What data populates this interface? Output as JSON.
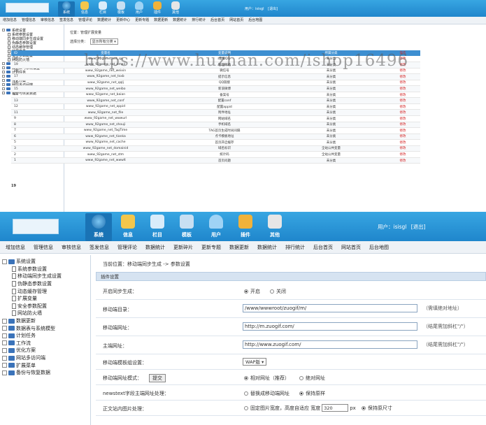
{
  "colors": {
    "header_blue": "#2a96da",
    "menu_bg": "#eef2f6",
    "table_head": "#3d8fd1",
    "op_red": "#d42020"
  },
  "shot1": {
    "nav_icons": [
      {
        "label": "系统",
        "icon": "globe-icon",
        "active": true
      },
      {
        "label": "信息",
        "icon": "pencil-icon"
      },
      {
        "label": "栏目",
        "icon": "folder-icon"
      },
      {
        "label": "模板",
        "icon": "template-icon"
      },
      {
        "label": "用户",
        "icon": "user-icon"
      },
      {
        "label": "插件",
        "icon": "tools-icon"
      },
      {
        "label": "其他",
        "icon": "gear-icon"
      }
    ],
    "user": {
      "label": "用户：isisgl",
      "logout": "[退出]"
    },
    "menu": [
      "增加信息",
      "管理信息",
      "审核信息",
      "签发信息",
      "管理评论",
      "数据统计",
      "更新中心",
      "更新专题",
      "数据更新",
      "数据统计",
      "排行统计",
      "后台首页",
      "网站首页",
      "后台地图"
    ],
    "tree": [
      {
        "label": "系统设置",
        "level": 0,
        "type": "folder"
      },
      {
        "label": "系统参数设置",
        "level": 1,
        "type": "doc"
      },
      {
        "label": "移动端同步生成设置",
        "level": 1,
        "type": "doc"
      },
      {
        "label": "伪静态参数设置",
        "level": 1,
        "type": "doc"
      },
      {
        "label": "动态缓存管理",
        "level": 1,
        "type": "doc"
      },
      {
        "label": "扩展变量",
        "level": 1,
        "type": "doc"
      },
      {
        "label": "安全参数配置",
        "level": 1,
        "type": "doc"
      },
      {
        "label": "网站防火墙",
        "level": 1,
        "type": "doc"
      },
      {
        "label": "数据更新",
        "level": 0,
        "type": "folder"
      },
      {
        "label": "数据表与系统模型",
        "level": 0,
        "type": "folder"
      },
      {
        "label": "计划任务",
        "level": 0,
        "type": "folder"
      },
      {
        "label": "工作流",
        "level": 0,
        "type": "folder"
      },
      {
        "label": "优化方案",
        "level": 0,
        "type": "folder"
      },
      {
        "label": "网站多访问端",
        "level": 0,
        "type": "folder"
      },
      {
        "label": "扩展菜单",
        "level": 0,
        "type": "folder"
      },
      {
        "label": "备份与恢复数据",
        "level": 0,
        "type": "folder"
      }
    ],
    "location": "位置：管理扩展变量",
    "filter": {
      "label": "选择分类：",
      "value": "显示所有分类"
    },
    "table_headers": [
      "ID",
      "变量名",
      "变量说明",
      "所属分类",
      "操作"
    ],
    "rows": [
      {
        "id": "20",
        "name": "www_92game_net_qq",
        "desc": "客服QQ",
        "group": "未分类",
        "op": "修改"
      },
      {
        "id": "19",
        "name": "www_92game_net_email",
        "desc": "管理邮箱",
        "group": "未分类",
        "op": "修改"
      },
      {
        "id": "18",
        "name": "www_92game_net_weixin",
        "desc": "微信号",
        "group": "未分类",
        "op": "修改"
      },
      {
        "id": "17",
        "name": "www_92game_net_tsxb",
        "desc": "提示信息",
        "group": "未分类",
        "op": "修改"
      },
      {
        "id": "16",
        "name": "www_92game_net_qqlj",
        "desc": "QQ链接",
        "group": "未分类",
        "op": "修改"
      },
      {
        "id": "15",
        "name": "www_92game_net_weibo",
        "desc": "新浪微博",
        "group": "未分类",
        "op": "修改"
      },
      {
        "id": "14",
        "name": "www_92game_net_baian",
        "desc": "备案号",
        "group": "未分类",
        "op": "修改"
      },
      {
        "id": "13",
        "name": "www_92game_net_conf",
        "desc": "配置conf",
        "group": "未分类",
        "op": "修改"
      },
      {
        "id": "12",
        "name": "www_92game_net_appid",
        "desc": "配置appid",
        "group": "未分类",
        "op": "修改"
      },
      {
        "id": "11",
        "name": "www_92game_net_file",
        "desc": "附件地址",
        "group": "未分类",
        "op": "修改"
      },
      {
        "id": "9",
        "name": "www_92game_net_wwwurl",
        "desc": "网站域名",
        "group": "未分类",
        "op": "修改"
      },
      {
        "id": "8",
        "name": "www_92game_net_shouji",
        "desc": "手机域名",
        "group": "未分类",
        "op": "修改"
      },
      {
        "id": "7",
        "name": "www_92game_net_TagTime",
        "desc": "TAG首页生成时间间隔",
        "group": "未分类",
        "op": "修改"
      },
      {
        "id": "6",
        "name": "www_92game_net_tianka",
        "desc": "点卡模板地址",
        "group": "未分类",
        "op": "修改"
      },
      {
        "id": "5",
        "name": "www_92game_net_cache",
        "desc": "首页开启缓存",
        "group": "未分类",
        "op": "修改"
      },
      {
        "id": "3",
        "name": "www_92game_net_domainid",
        "desc": "域名标识",
        "group": "全站公共变量",
        "op": "修改"
      },
      {
        "id": "2",
        "name": "www_92game_net_stm",
        "desc": "统计码",
        "group": "全站公共变量",
        "op": "修改"
      },
      {
        "id": "1",
        "name": "www_92game_net_wwwlt",
        "desc": "首页问题",
        "group": "未分类",
        "op": "修改"
      }
    ],
    "page": "19"
  },
  "watermark": "https://www.huzhan.com/ishop16496",
  "shot2": {
    "nav_icons": [
      {
        "label": "系统",
        "icon": "globe-icon",
        "active": true
      },
      {
        "label": "信息",
        "icon": "pencil-icon"
      },
      {
        "label": "栏目",
        "icon": "folder-icon"
      },
      {
        "label": "模板",
        "icon": "template-icon"
      },
      {
        "label": "用户",
        "icon": "user-icon"
      },
      {
        "label": "插件",
        "icon": "tools-icon"
      },
      {
        "label": "其他",
        "icon": "gear-icon"
      }
    ],
    "user": {
      "label": "用户：isisgl",
      "logout": "[退出]"
    },
    "menu": [
      "增加信息",
      "管理信息",
      "审核信息",
      "签发信息",
      "管理评论",
      "数据统计",
      "更新碎片",
      "更新专题",
      "数据更新",
      "数据统计",
      "排行统计",
      "后台首页",
      "网站首页",
      "后台地图"
    ],
    "tree": [
      {
        "label": "系统设置",
        "level": 0,
        "type": "folder"
      },
      {
        "label": "系统参数设置",
        "level": 1,
        "type": "doc"
      },
      {
        "label": "移动端同步生成设置",
        "level": 1,
        "type": "doc"
      },
      {
        "label": "伪静态参数设置",
        "level": 1,
        "type": "doc"
      },
      {
        "label": "动态缓存管理",
        "level": 1,
        "type": "doc"
      },
      {
        "label": "扩展变量",
        "level": 1,
        "type": "doc"
      },
      {
        "label": "安全参数配置",
        "level": 1,
        "type": "doc"
      },
      {
        "label": "网站防火墙",
        "level": 1,
        "type": "doc"
      },
      {
        "label": "数据更新",
        "level": 0,
        "type": "folder"
      },
      {
        "label": "数据表与系统模型",
        "level": 0,
        "type": "folder"
      },
      {
        "label": "计划任务",
        "level": 0,
        "type": "folder"
      },
      {
        "label": "工作流",
        "level": 0,
        "type": "folder"
      },
      {
        "label": "优化方案",
        "level": 0,
        "type": "folder"
      },
      {
        "label": "网站多访问端",
        "level": 0,
        "type": "folder"
      },
      {
        "label": "扩展菜单",
        "level": 0,
        "type": "folder"
      },
      {
        "label": "备份与恢复数据",
        "level": 0,
        "type": "folder"
      }
    ],
    "location": "当前位置：移动端同步生成 -> 参数设置",
    "section_title": "插件设置",
    "form": {
      "sync": {
        "label": "开启同步生成：",
        "opt_on": "开启",
        "opt_off": "关闭"
      },
      "mobile_dir": {
        "label": "移动端目录：",
        "value": "/www/wwwroot/zuogif/m/",
        "hint": "（需填绝对地址）"
      },
      "mobile_url": {
        "label": "移动端网址：",
        "value": "http://m.zuogif.com/",
        "hint": "（结尾需加斜杠\"/\"）"
      },
      "main_url": {
        "label": "主端网址：",
        "value": "http://www.zuogif.com/",
        "hint": "（结尾需加斜杠\"/\"）"
      },
      "template": {
        "label": "移动端模板组设置：",
        "value": "WAP版"
      },
      "url_mode": {
        "label": "移动端网址模式：",
        "opt1": "相对网址（推荐）",
        "opt2": "绝对网址"
      },
      "newstext": {
        "label": "newstext字段主端网址处理：",
        "opt1": "替换成移动端网址",
        "opt2": "保持原样"
      },
      "image": {
        "label": "正文站内图片处理：",
        "opt1": "固定图片宽度，高度自适应 宽度",
        "width": "320",
        "unit": "px",
        "opt2": "保持原尺寸"
      },
      "submit": "提交"
    }
  }
}
